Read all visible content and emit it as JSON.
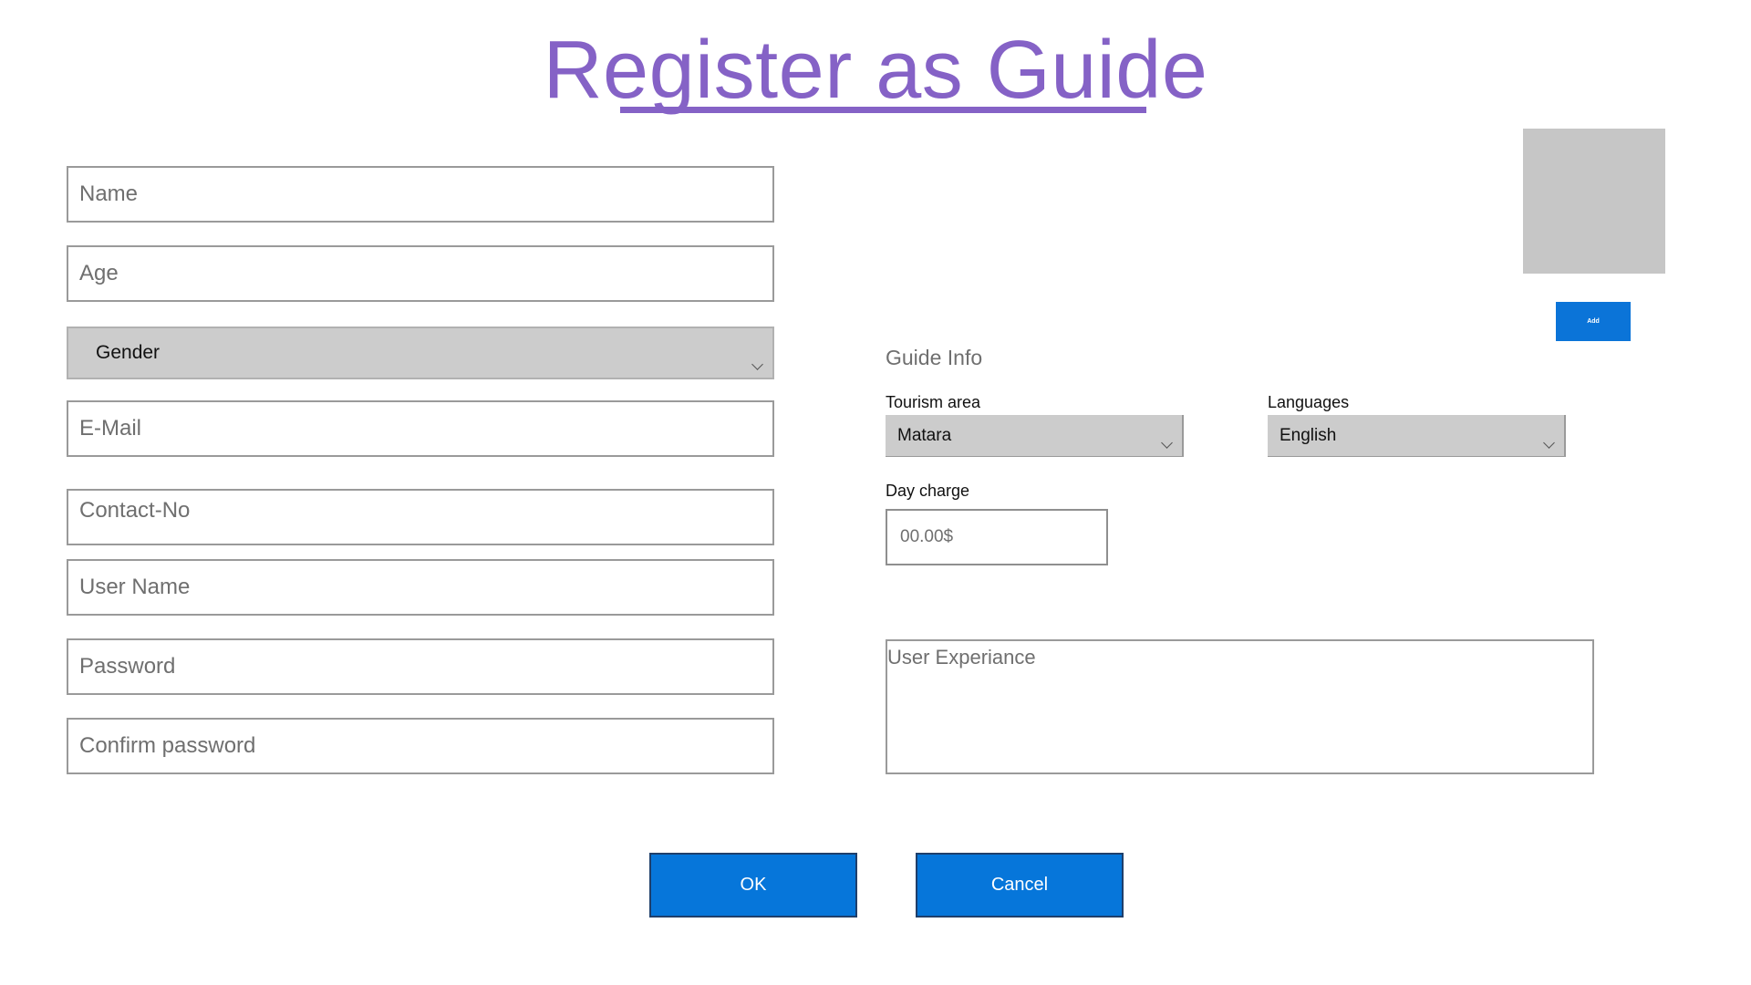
{
  "page": {
    "title": "Register as Guide"
  },
  "personal_fields": {
    "name_placeholder": "Name",
    "age_placeholder": "Age",
    "gender_value": "Gender",
    "email_placeholder": "E-Mail",
    "contact_placeholder": "Contact-No",
    "username_placeholder": "User Name",
    "password_placeholder": "Password",
    "confirm_password_placeholder": "Confirm password"
  },
  "guide_info": {
    "heading": "Guide Info",
    "tourism_area_label": "Tourism area",
    "tourism_area_value": "Matara",
    "languages_label": "Languages",
    "languages_value": "English",
    "day_charge_label": "Day charge",
    "day_charge_placeholder": "00.00$",
    "experience_placeholder": "User Experiance"
  },
  "photo": {
    "add_label": "Add"
  },
  "actions": {
    "ok_label": "OK",
    "cancel_label": "Cancel"
  },
  "colors": {
    "title": "#8562c6",
    "button": "#0676da",
    "combo_bg": "#cccccc",
    "photo_placeholder": "#c6c6c6"
  }
}
